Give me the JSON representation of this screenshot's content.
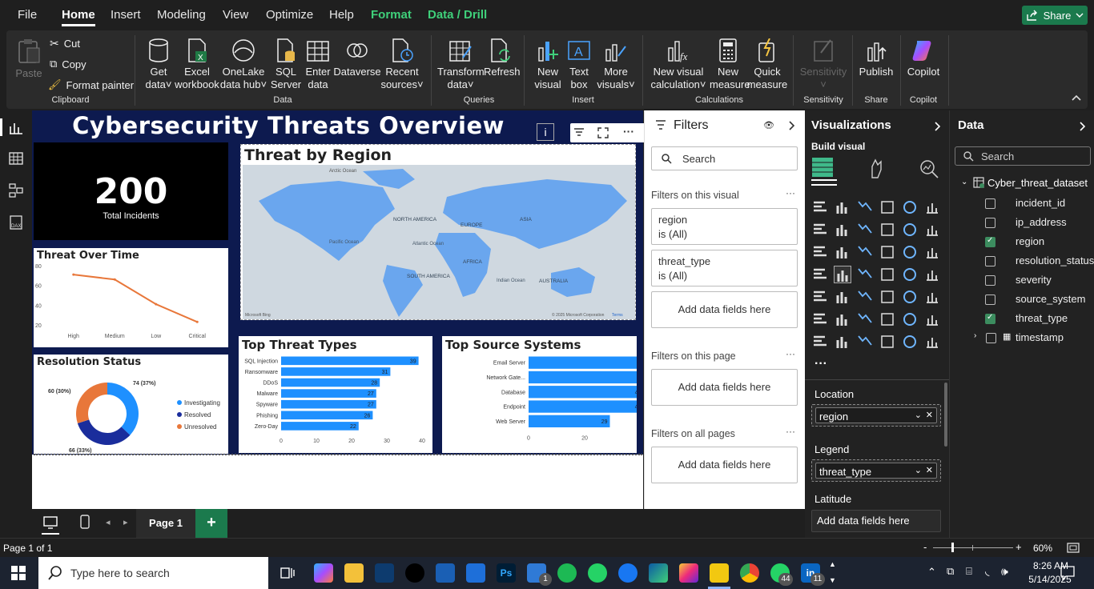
{
  "menu": {
    "file": "File",
    "home": "Home",
    "insert": "Insert",
    "modeling": "Modeling",
    "view": "View",
    "optimize": "Optimize",
    "help": "Help",
    "format": "Format",
    "data_drill": "Data / Drill",
    "share": "Share"
  },
  "ribbon": {
    "paste": "Paste",
    "cut": "Cut",
    "copy": "Copy",
    "format_painter": "Format painter",
    "clipboard": "Clipboard",
    "get_data_1": "Get",
    "get_data_2": "data",
    "excel_1": "Excel",
    "excel_2": "workbook",
    "onelake_1": "OneLake",
    "onelake_2": "data hub",
    "sql_1": "SQL",
    "sql_2": "Server",
    "enter_1": "Enter",
    "enter_2": "data",
    "dataverse": "Dataverse",
    "recent_1": "Recent",
    "recent_2": "sources",
    "data_group": "Data",
    "transform_1": "Transform",
    "transform_2": "data",
    "refresh": "Refresh",
    "queries_group": "Queries",
    "new_visual_1": "New",
    "new_visual_2": "visual",
    "text_box_1": "Text",
    "text_box_2": "box",
    "more_visuals_1": "More",
    "more_visuals_2": "visuals",
    "insert_group": "Insert",
    "new_visual_calc_1": "New visual",
    "new_visual_calc_2": "calculation",
    "new_measure_1": "New",
    "new_measure_2": "measure",
    "quick_measure_1": "Quick",
    "quick_measure_2": "measure",
    "calculations_group": "Calculations",
    "sensitivity": "Sensitivity",
    "sensitivity_group": "Sensitivity",
    "publish": "Publish",
    "share_group": "Share",
    "copilot": "Copilot",
    "copilot_group": "Copilot"
  },
  "report": {
    "title": "Cybersecurity Threats Overview",
    "kpi_value": "200",
    "kpi_label": "Total Incidents",
    "map_title": "Threat by Region",
    "map_labels": {
      "arctic": "Arctic Ocean",
      "north_america": "NORTH AMERICA",
      "europe": "EUROPE",
      "asia": "ASIA",
      "pacific": "Pacific Ocean",
      "atlantic": "Atlantic Ocean",
      "africa": "AFRICA",
      "south_america": "SOUTH AMERICA",
      "indian": "Indian Ocean",
      "australia": "AUSTRALIA",
      "bing": "Microsoft Bing",
      "copyright": "© 2025 Microsoft Corporation",
      "terms": "Terms"
    },
    "line_title": "Threat Over Time",
    "donut_title": "Resolution Status",
    "threat_types_title": "Top Threat Types",
    "source_systems_title": "Top Source Systems"
  },
  "chart_data": [
    {
      "type": "line",
      "title": "Threat Over Time",
      "categories": [
        "High",
        "Medium",
        "Low",
        "Critical"
      ],
      "values": [
        71,
        66,
        41,
        23
      ],
      "ylim": [
        20,
        80
      ],
      "yticks": [
        20,
        40,
        60,
        80
      ],
      "color": "#e8773a"
    },
    {
      "type": "pie",
      "title": "Resolution Status",
      "labels": [
        "Investigating",
        "Resolved",
        "Unresolved"
      ],
      "values": [
        74,
        66,
        60
      ],
      "data_labels": [
        "74 (37%)",
        "66 (33%)",
        "60 (30%)"
      ],
      "colors": [
        "#1e90ff",
        "#1a2d9c",
        "#e8773a"
      ],
      "legend": "right"
    },
    {
      "type": "bar",
      "title": "Top Threat Types",
      "categories": [
        "SQL Injection",
        "Ransomware",
        "DDoS",
        "Malware",
        "Spyware",
        "Phishing",
        "Zero-Day"
      ],
      "values": [
        39,
        31,
        28,
        27,
        27,
        26,
        22
      ],
      "xlim": [
        0,
        40
      ],
      "xticks": [
        0,
        10,
        20,
        30,
        40
      ],
      "color": "#1e90ff"
    },
    {
      "type": "bar",
      "title": "Top Source Systems",
      "categories": [
        "Email Server",
        "Network Gate...",
        "Database",
        "Endpoint",
        "Web Server"
      ],
      "values": [
        46,
        43,
        41,
        41,
        29
      ],
      "xlim": [
        0,
        48
      ],
      "xticks": [
        0,
        20,
        40
      ],
      "color": "#1e90ff"
    }
  ],
  "filters": {
    "title": "Filters",
    "search_placeholder": "Search",
    "on_visual": "Filters on this visual",
    "f1_name": "region",
    "f1_value": "is (All)",
    "f2_name": "threat_type",
    "f2_value": "is (All)",
    "add_fields": "Add data fields here",
    "on_page": "Filters on this page",
    "on_all": "Filters on all pages"
  },
  "viz": {
    "title": "Visualizations",
    "build": "Build visual",
    "location": "Location",
    "location_value": "region",
    "legend": "Legend",
    "legend_value": "threat_type",
    "latitude": "Latitude",
    "add_fields": "Add data fields here"
  },
  "datapane": {
    "title": "Data",
    "search_placeholder": "Search",
    "table": "Cyber_threat_dataset",
    "fields": [
      {
        "name": "incident_id",
        "checked": false
      },
      {
        "name": "ip_address",
        "checked": false
      },
      {
        "name": "region",
        "checked": true
      },
      {
        "name": "resolution_status",
        "checked": false
      },
      {
        "name": "severity",
        "checked": false
      },
      {
        "name": "source_system",
        "checked": false
      },
      {
        "name": "threat_type",
        "checked": true
      },
      {
        "name": "timestamp",
        "checked": false
      }
    ]
  },
  "pagebar": {
    "page": "Page 1",
    "add": "+"
  },
  "status": {
    "page_info": "Page 1 of 1",
    "zoom": "60%"
  },
  "taskbar": {
    "search": "Type here to search",
    "time": "8:26 AM",
    "date": "5/14/2025",
    "badge1": "1",
    "badge2": "44",
    "badge3": "11"
  }
}
